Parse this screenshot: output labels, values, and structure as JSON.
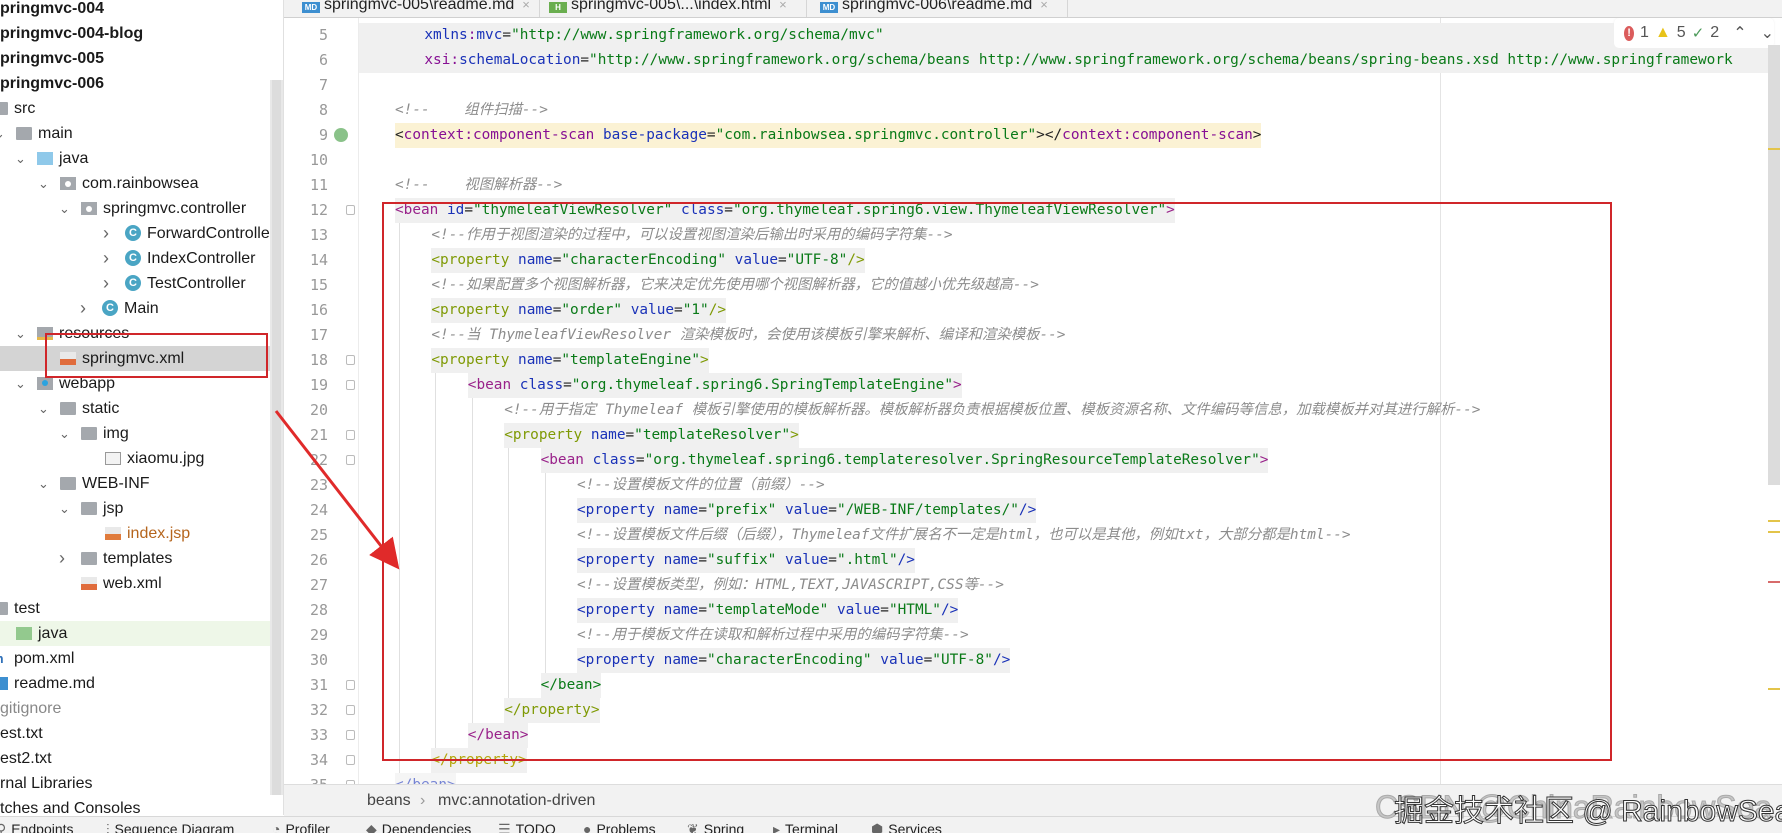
{
  "sidebar": {
    "items": [
      {
        "label": "pringmvc-004",
        "icon": "none"
      },
      {
        "label": "pringmvc-004-blog",
        "icon": "none"
      },
      {
        "label": "pringmvc-005",
        "icon": "none"
      },
      {
        "label": "pringmvc-006",
        "icon": "none"
      },
      {
        "label": "src",
        "icon": "folder"
      },
      {
        "label": "main",
        "icon": "folder"
      },
      {
        "label": "java",
        "icon": "folder-blue"
      },
      {
        "label": "com.rainbowsea",
        "icon": "package"
      },
      {
        "label": "springmvc.controller",
        "icon": "package"
      },
      {
        "label": "ForwardController",
        "icon": "class"
      },
      {
        "label": "IndexController",
        "icon": "class"
      },
      {
        "label": "TestController",
        "icon": "class"
      },
      {
        "label": "Main",
        "icon": "class"
      },
      {
        "label": "resources",
        "icon": "resources-folder"
      },
      {
        "label": "springmvc.xml",
        "icon": "xml-file"
      },
      {
        "label": "webapp",
        "icon": "web-folder"
      },
      {
        "label": "static",
        "icon": "folder"
      },
      {
        "label": "img",
        "icon": "folder"
      },
      {
        "label": "xiaomu.jpg",
        "icon": "image-file"
      },
      {
        "label": "WEB-INF",
        "icon": "folder"
      },
      {
        "label": "jsp",
        "icon": "folder"
      },
      {
        "label": "index.jsp",
        "icon": "jsp-file"
      },
      {
        "label": "templates",
        "icon": "folder"
      },
      {
        "label": "web.xml",
        "icon": "xml-file"
      },
      {
        "label": "test",
        "icon": "folder"
      },
      {
        "label": "java",
        "icon": "folder-green"
      },
      {
        "label": "pom.xml",
        "icon": "maven"
      },
      {
        "label": "readme.md",
        "icon": "markdown"
      },
      {
        "label": "gitignore",
        "icon": "none"
      },
      {
        "label": "est.txt",
        "icon": "none"
      },
      {
        "label": "est2.txt",
        "icon": "none"
      },
      {
        "label": "rnal Libraries",
        "icon": "none"
      },
      {
        "label": "tches and Consoles",
        "icon": "none"
      }
    ]
  },
  "tabs": [
    {
      "label": "springmvc-005\\readme.md",
      "icon": "MD",
      "icon_color": "#3d8fd0"
    },
    {
      "label": "springmvc-005\\...\\index.html",
      "icon": "H",
      "icon_color": "#6aae4f"
    },
    {
      "label": "springmvc-006\\readme.md",
      "icon": "MD",
      "icon_color": "#3d8fd0"
    }
  ],
  "tab_close": "×",
  "inspections": {
    "errors": "1",
    "warnings": "5",
    "weak_warnings": "2",
    "up": "⌃",
    "down": "⌄"
  },
  "code": {
    "lines": [
      {
        "n": "5",
        "tokens": [
          [
            "a",
            "xmlns"
          ],
          [
            "x",
            ":"
          ],
          [
            "a",
            "mvc"
          ],
          [
            "t",
            "="
          ],
          [
            "s",
            "\"http://www.springframework.org/schema/mvc\""
          ]
        ]
      },
      {
        "n": "6",
        "tokens": [
          [
            "x",
            "xsi"
          ],
          [
            "x",
            ":"
          ],
          [
            "a",
            "schemaLocation"
          ],
          [
            "t",
            "="
          ],
          [
            "s",
            "\"http://www.springframework.org/schema/beans http://www.springframework.org/schema/beans/spring-beans.xsd http://www.springframework"
          ]
        ]
      },
      {
        "n": "7",
        "tokens": []
      },
      {
        "n": "8",
        "tokens": [
          [
            "c",
            "<!--    组件扫描-->"
          ]
        ]
      },
      {
        "n": "9",
        "tokens": [
          [
            "t",
            "<"
          ],
          [
            "k",
            "context:component-scan"
          ],
          [
            "t",
            " "
          ],
          [
            "a",
            "base-package"
          ],
          [
            "t",
            "="
          ],
          [
            "s",
            "\"com.rainbowsea.springmvc.controller\""
          ],
          [
            "t",
            ">"
          ],
          [
            "t",
            "</"
          ],
          [
            "k",
            "context:component-scan"
          ],
          [
            "t",
            ">"
          ]
        ]
      },
      {
        "n": "10",
        "tokens": []
      },
      {
        "n": "11",
        "tokens": [
          [
            "c",
            "<!--    视图解析器-->"
          ]
        ]
      },
      {
        "n": "12",
        "tokens": [
          [
            "b",
            "<bean"
          ],
          [
            "t",
            " "
          ],
          [
            "a",
            "id"
          ],
          [
            "t",
            "="
          ],
          [
            "s",
            "\"thymeleafViewResolver\""
          ],
          [
            "t",
            " "
          ],
          [
            "a",
            "class"
          ],
          [
            "t",
            "="
          ],
          [
            "s",
            "\"org.thymeleaf.spring6.view.ThymeleafViewResolver\""
          ],
          [
            "b",
            ">"
          ]
        ]
      },
      {
        "n": "13",
        "tokens": [
          [
            "c",
            "<!--作用于视图渲染的过程中，可以设置视图渲染后输出时采用的编码字符集-->"
          ]
        ]
      },
      {
        "n": "14",
        "tokens": [
          [
            "p",
            "<property"
          ],
          [
            "t",
            " "
          ],
          [
            "a",
            "name"
          ],
          [
            "t",
            "="
          ],
          [
            "s",
            "\"characterEncoding\""
          ],
          [
            "t",
            " "
          ],
          [
            "a",
            "value"
          ],
          [
            "t",
            "="
          ],
          [
            "s",
            "\"UTF-8\""
          ],
          [
            "p",
            "/>"
          ]
        ]
      },
      {
        "n": "15",
        "tokens": [
          [
            "c",
            "<!--如果配置多个视图解析器，它来决定优先使用哪个视图解析器，它的值越小优先级越高-->"
          ]
        ]
      },
      {
        "n": "16",
        "tokens": [
          [
            "p",
            "<property"
          ],
          [
            "t",
            " "
          ],
          [
            "a",
            "name"
          ],
          [
            "t",
            "="
          ],
          [
            "s",
            "\"order\""
          ],
          [
            "t",
            " "
          ],
          [
            "a",
            "value"
          ],
          [
            "t",
            "="
          ],
          [
            "s",
            "\"1\""
          ],
          [
            "p",
            "/>"
          ]
        ]
      },
      {
        "n": "17",
        "tokens": [
          [
            "c",
            "<!--当 ThymeleafViewResolver 渲染模板时，会使用该模板引擎来解析、编译和渲染模板-->"
          ]
        ]
      },
      {
        "n": "18",
        "tokens": [
          [
            "p",
            "<property"
          ],
          [
            "t",
            " "
          ],
          [
            "a",
            "name"
          ],
          [
            "t",
            "="
          ],
          [
            "s",
            "\"templateEngine\""
          ],
          [
            "p",
            ">"
          ]
        ]
      },
      {
        "n": "19",
        "tokens": [
          [
            "b",
            "<bean"
          ],
          [
            "t",
            " "
          ],
          [
            "a",
            "class"
          ],
          [
            "t",
            "="
          ],
          [
            "s",
            "\"org.thymeleaf.spring6.SpringTemplateEngine\""
          ],
          [
            "b",
            ">"
          ]
        ]
      },
      {
        "n": "20",
        "tokens": [
          [
            "c",
            "<!--用于指定 Thymeleaf 模板引擎使用的模板解析器。模板解析器负责根据模板位置、模板资源名称、文件编码等信息，加载模板并对其进行解析-->"
          ]
        ]
      },
      {
        "n": "21",
        "tokens": [
          [
            "p",
            "<property"
          ],
          [
            "t",
            " "
          ],
          [
            "a",
            "name"
          ],
          [
            "t",
            "="
          ],
          [
            "s",
            "\"templateResolver\""
          ],
          [
            "p",
            ">"
          ]
        ]
      },
      {
        "n": "22",
        "tokens": [
          [
            "b",
            "<bean"
          ],
          [
            "t",
            " "
          ],
          [
            "a",
            "class"
          ],
          [
            "t",
            "="
          ],
          [
            "s",
            "\"org.thymeleaf.spring6.templateresolver.SpringResourceTemplateResolver\""
          ],
          [
            "b",
            ">"
          ]
        ]
      },
      {
        "n": "23",
        "tokens": [
          [
            "c",
            "<!--设置模板文件的位置（前缀）-->"
          ]
        ]
      },
      {
        "n": "24",
        "tokens": [
          [
            "a",
            "<property"
          ],
          [
            "t",
            " "
          ],
          [
            "a",
            "name"
          ],
          [
            "t",
            "="
          ],
          [
            "s",
            "\"prefix\""
          ],
          [
            "t",
            " "
          ],
          [
            "a",
            "value"
          ],
          [
            "t",
            "="
          ],
          [
            "s",
            "\"/WEB-INF/templates/\""
          ],
          [
            "a",
            "/>"
          ]
        ]
      },
      {
        "n": "25",
        "tokens": [
          [
            "c",
            "<!--设置模板文件后缀（后缀），Thymeleaf文件扩展名不一定是html，也可以是其他，例如txt，大部分都是html-->"
          ]
        ]
      },
      {
        "n": "26",
        "tokens": [
          [
            "a",
            "<property"
          ],
          [
            "t",
            " "
          ],
          [
            "a",
            "name"
          ],
          [
            "t",
            "="
          ],
          [
            "s",
            "\"suffix\""
          ],
          [
            "t",
            " "
          ],
          [
            "a",
            "value"
          ],
          [
            "t",
            "="
          ],
          [
            "s",
            "\".html\""
          ],
          [
            "a",
            "/>"
          ]
        ]
      },
      {
        "n": "27",
        "tokens": [
          [
            "c",
            "<!--设置模板类型，例如：HTML,TEXT,JAVASCRIPT,CSS等-->"
          ]
        ]
      },
      {
        "n": "28",
        "tokens": [
          [
            "a",
            "<property"
          ],
          [
            "t",
            " "
          ],
          [
            "a",
            "name"
          ],
          [
            "t",
            "="
          ],
          [
            "s",
            "\"templateMode\""
          ],
          [
            "t",
            " "
          ],
          [
            "a",
            "value"
          ],
          [
            "t",
            "="
          ],
          [
            "s",
            "\"HTML\""
          ],
          [
            "a",
            "/>"
          ]
        ]
      },
      {
        "n": "29",
        "tokens": [
          [
            "c",
            "<!--用于模板文件在读取和解析过程中采用的编码字符集-->"
          ]
        ]
      },
      {
        "n": "30",
        "tokens": [
          [
            "a",
            "<property"
          ],
          [
            "t",
            " "
          ],
          [
            "a",
            "name"
          ],
          [
            "t",
            "="
          ],
          [
            "s",
            "\"characterEncoding\""
          ],
          [
            "t",
            " "
          ],
          [
            "a",
            "value"
          ],
          [
            "t",
            "="
          ],
          [
            "s",
            "\"UTF-8\""
          ],
          [
            "a",
            "/>"
          ]
        ]
      },
      {
        "n": "31",
        "tokens": [
          [
            "s",
            "</bean>"
          ]
        ]
      },
      {
        "n": "32",
        "tokens": [
          [
            "p",
            "</property>"
          ]
        ]
      },
      {
        "n": "33",
        "tokens": [
          [
            "b",
            "</bean>"
          ]
        ]
      },
      {
        "n": "34",
        "tokens": [
          [
            "p2",
            "</property>"
          ]
        ]
      },
      {
        "n": "35",
        "tokens": [
          [
            "a",
            "</bean>"
          ]
        ]
      }
    ]
  },
  "breadcrumb": {
    "items": [
      "beans",
      "mvc:annotation-driven"
    ],
    "separator": "›"
  },
  "toolbar": {
    "items": [
      {
        "label": "Endpoints",
        "icon": "⚲"
      },
      {
        "label": "Sequence Diagram",
        "icon": "⫶"
      },
      {
        "label": "Profiler",
        "icon": "◔"
      },
      {
        "label": "Dependencies",
        "icon": "◆"
      },
      {
        "label": "TODO",
        "icon": "☰"
      },
      {
        "label": "Problems",
        "icon": "●"
      },
      {
        "label": "Spring",
        "icon": "❦"
      },
      {
        "label": "Terminal",
        "icon": "▸"
      },
      {
        "label": "Services",
        "icon": "⬢"
      }
    ]
  },
  "watermark": {
    "text": "掘金技术社区 @ RainbowSea",
    "ghost": "CSDN @ChinaRainbowSea"
  }
}
